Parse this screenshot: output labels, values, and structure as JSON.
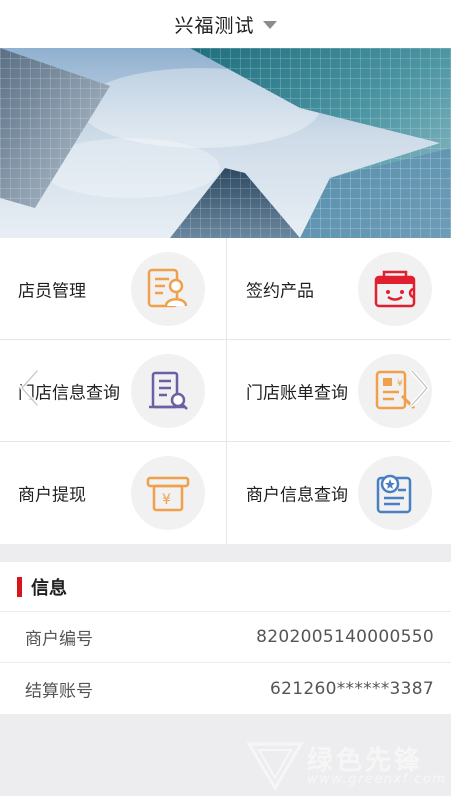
{
  "header": {
    "title": "兴福测试"
  },
  "grid": {
    "items": [
      {
        "label": "店员管理",
        "icon": "staff-management-icon"
      },
      {
        "label": "签约产品",
        "icon": "signed-product-icon"
      },
      {
        "label": "门店信息查询",
        "icon": "store-info-query-icon"
      },
      {
        "label": "门店账单查询",
        "icon": "store-bill-query-icon"
      },
      {
        "label": "商户提现",
        "icon": "merchant-withdraw-icon"
      },
      {
        "label": "商户信息查询",
        "icon": "merchant-info-query-icon"
      }
    ]
  },
  "info": {
    "title": "信息",
    "rows": [
      {
        "key": "商户编号",
        "value": "8202005140000550"
      },
      {
        "key": "结算账号",
        "value": "621260******3387"
      }
    ]
  },
  "watermark": {
    "text": "绿色先锋",
    "url": "www.greenxf.com"
  },
  "colors": {
    "accent": "#d7161c",
    "icon_orange": "#f0a04b",
    "icon_red": "#e0202e",
    "icon_purple": "#6d5fa3",
    "icon_blue": "#4a7fc1"
  }
}
